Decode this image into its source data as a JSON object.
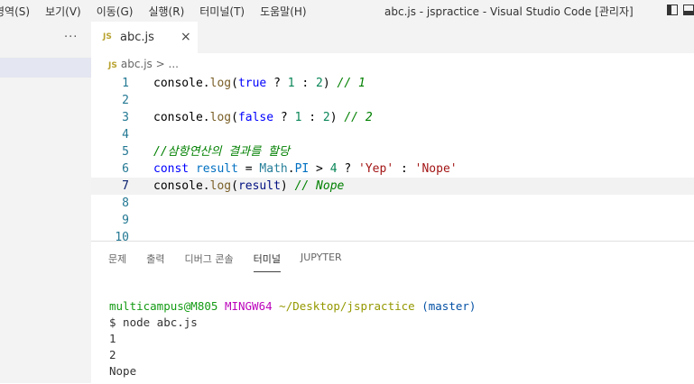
{
  "menu": {
    "items": [
      "영역(S)",
      "보기(V)",
      "이동(G)",
      "실행(R)",
      "터미널(T)",
      "도움말(H)"
    ]
  },
  "window": {
    "title": "abc.js - jspractice - Visual Studio Code [관리자]"
  },
  "sidebar": {
    "more_label": "···"
  },
  "tab": {
    "icon_text": "JS",
    "label": "abc.js",
    "close_label": "×"
  },
  "breadcrumb": {
    "icon_text": "JS",
    "file": "abc.js",
    "separator": ">",
    "trail": "..."
  },
  "editor": {
    "line_numbers": [
      "1",
      "2",
      "3",
      "4",
      "5",
      "6",
      "7",
      "8",
      "9",
      "10"
    ],
    "current_line": 7,
    "lines": [
      [
        {
          "t": "console",
          "c": "t-plain"
        },
        {
          "t": ".",
          "c": "t-plain"
        },
        {
          "t": "log",
          "c": "t-fn"
        },
        {
          "t": "(",
          "c": "t-plain"
        },
        {
          "t": "true",
          "c": "t-kw"
        },
        {
          "t": " ? ",
          "c": "t-op"
        },
        {
          "t": "1",
          "c": "t-num"
        },
        {
          "t": " : ",
          "c": "t-op"
        },
        {
          "t": "2",
          "c": "t-num"
        },
        {
          "t": ") ",
          "c": "t-plain"
        },
        {
          "t": "// 1",
          "c": "t-cmt"
        }
      ],
      [],
      [
        {
          "t": "console",
          "c": "t-plain"
        },
        {
          "t": ".",
          "c": "t-plain"
        },
        {
          "t": "log",
          "c": "t-fn"
        },
        {
          "t": "(",
          "c": "t-plain"
        },
        {
          "t": "false",
          "c": "t-kw"
        },
        {
          "t": " ? ",
          "c": "t-op"
        },
        {
          "t": "1",
          "c": "t-num"
        },
        {
          "t": " : ",
          "c": "t-op"
        },
        {
          "t": "2",
          "c": "t-num"
        },
        {
          "t": ") ",
          "c": "t-plain"
        },
        {
          "t": "// 2",
          "c": "t-cmt"
        }
      ],
      [],
      [
        {
          "t": "//삼항연산의 결과를 할당",
          "c": "t-cmt"
        }
      ],
      [
        {
          "t": "const",
          "c": "t-kw"
        },
        {
          "t": " ",
          "c": "t-plain"
        },
        {
          "t": "result",
          "c": "t-const"
        },
        {
          "t": " = ",
          "c": "t-op"
        },
        {
          "t": "Math",
          "c": "t-cls"
        },
        {
          "t": ".",
          "c": "t-plain"
        },
        {
          "t": "PI",
          "c": "t-const"
        },
        {
          "t": " > ",
          "c": "t-op"
        },
        {
          "t": "4",
          "c": "t-num"
        },
        {
          "t": " ? ",
          "c": "t-op"
        },
        {
          "t": "'Yep'",
          "c": "t-str"
        },
        {
          "t": " : ",
          "c": "t-op"
        },
        {
          "t": "'Nope'",
          "c": "t-str"
        }
      ],
      [
        {
          "t": "console",
          "c": "t-plain"
        },
        {
          "t": ".",
          "c": "t-plain"
        },
        {
          "t": "log",
          "c": "t-fn"
        },
        {
          "t": "(",
          "c": "t-plain"
        },
        {
          "t": "result",
          "c": "t-var"
        },
        {
          "t": ") ",
          "c": "t-plain"
        },
        {
          "t": "// Nope",
          "c": "t-cmt"
        }
      ],
      [],
      [],
      []
    ]
  },
  "panel": {
    "tabs": [
      "문제",
      "출력",
      "디버그 콘솔",
      "터미널",
      "JUPYTER"
    ],
    "active_tab": "터미널"
  },
  "terminal": {
    "prompt_user": "multicampus@M805",
    "prompt_host": "MINGW64",
    "prompt_path": "~/Desktop/jspractice",
    "prompt_branch": "(master)",
    "command": "$ node abc.js",
    "output": [
      "1",
      "2",
      "Nope"
    ]
  },
  "colors": {
    "js_icon": "#b8a22f",
    "line_number": "#237893",
    "current_line_bg": "#f2f2f2"
  }
}
